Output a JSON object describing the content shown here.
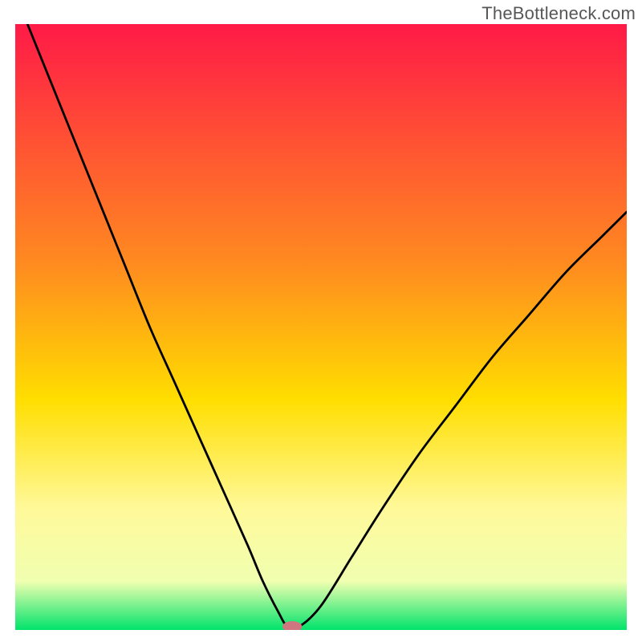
{
  "watermark": "TheBottleneck.com",
  "chart_data": {
    "type": "line",
    "title": "",
    "xlabel": "",
    "ylabel": "",
    "xlim": [
      0,
      100
    ],
    "ylim": [
      0,
      100
    ],
    "background_gradient": {
      "stops": [
        {
          "offset": 0,
          "color": "#ff1a47"
        },
        {
          "offset": 40,
          "color": "#ff8c1f"
        },
        {
          "offset": 62,
          "color": "#ffde00"
        },
        {
          "offset": 80,
          "color": "#fff99a"
        },
        {
          "offset": 92,
          "color": "#f0ffb0"
        },
        {
          "offset": 100,
          "color": "#00e36b"
        }
      ]
    },
    "series": [
      {
        "name": "bottleneck-curve",
        "stroke": "#000000",
        "stroke_width": 2.8,
        "x": [
          2,
          6,
          10,
          14,
          18,
          22,
          26,
          30,
          34,
          38,
          40.5,
          43,
          44.5,
          46.5,
          50,
          55,
          60,
          66,
          72,
          78,
          84,
          90,
          96,
          100
        ],
        "values": [
          100,
          90,
          80,
          70,
          60,
          50,
          41,
          32,
          23,
          14,
          8,
          3,
          0.6,
          0.6,
          4,
          12,
          20,
          29,
          37,
          45,
          52,
          59,
          65,
          69
        ]
      }
    ],
    "marker": {
      "name": "minimum-marker",
      "x": 45.3,
      "y": 0.55,
      "rx": 1.6,
      "ry": 0.9,
      "fill": "#cf7680"
    }
  }
}
